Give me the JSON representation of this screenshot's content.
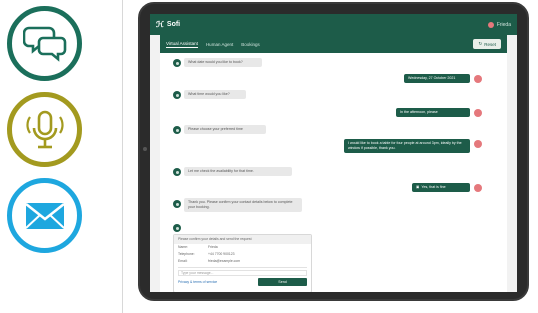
{
  "icons": {
    "chat": {
      "name": "chat-bubbles-icon",
      "color": "#1b6f5b"
    },
    "mic": {
      "name": "microphone-icon",
      "color": "#a39a1f"
    },
    "mail": {
      "name": "envelope-icon",
      "color": "#1ea7df"
    }
  },
  "app": {
    "brand": "Sofi",
    "brand_color": "#1d5c49",
    "user_name": "Frieda"
  },
  "tabs": [
    {
      "label": "Virtual Assistant",
      "active": true
    },
    {
      "label": "Human Agent",
      "active": false
    },
    {
      "label": "Bookings",
      "active": false
    }
  ],
  "reset_label": "Reset",
  "messages": [
    {
      "from": "bot",
      "text": "What date would you like to book?"
    },
    {
      "from": "user",
      "text": "Wednesday, 27 October 2021"
    },
    {
      "from": "bot",
      "text": "What time would you like?"
    },
    {
      "from": "user",
      "text": "In the afternoon, please"
    },
    {
      "from": "bot",
      "text": "Please choose your preferred time"
    },
    {
      "from": "user",
      "text": "I would like to book a table for four people at around 3pm, ideally by the window if possible, thank you."
    },
    {
      "from": "bot",
      "text": "Let me check the availability for that time."
    },
    {
      "from": "user",
      "text": "Yes, that is fine"
    },
    {
      "from": "bot",
      "text": "Thank you. Please confirm your contact details below to complete your booking."
    }
  ],
  "form": {
    "heading": "Please confirm your details and send the request",
    "rows": [
      {
        "key": "Name:",
        "value": "Frieda"
      },
      {
        "key": "Telephone:",
        "value": "+44 7700 900123"
      },
      {
        "key": "Email:",
        "value": "frieda@example.com"
      }
    ],
    "input_placeholder": "Type your message...",
    "link_text": "Privacy & terms of service",
    "send_label": "Send"
  }
}
